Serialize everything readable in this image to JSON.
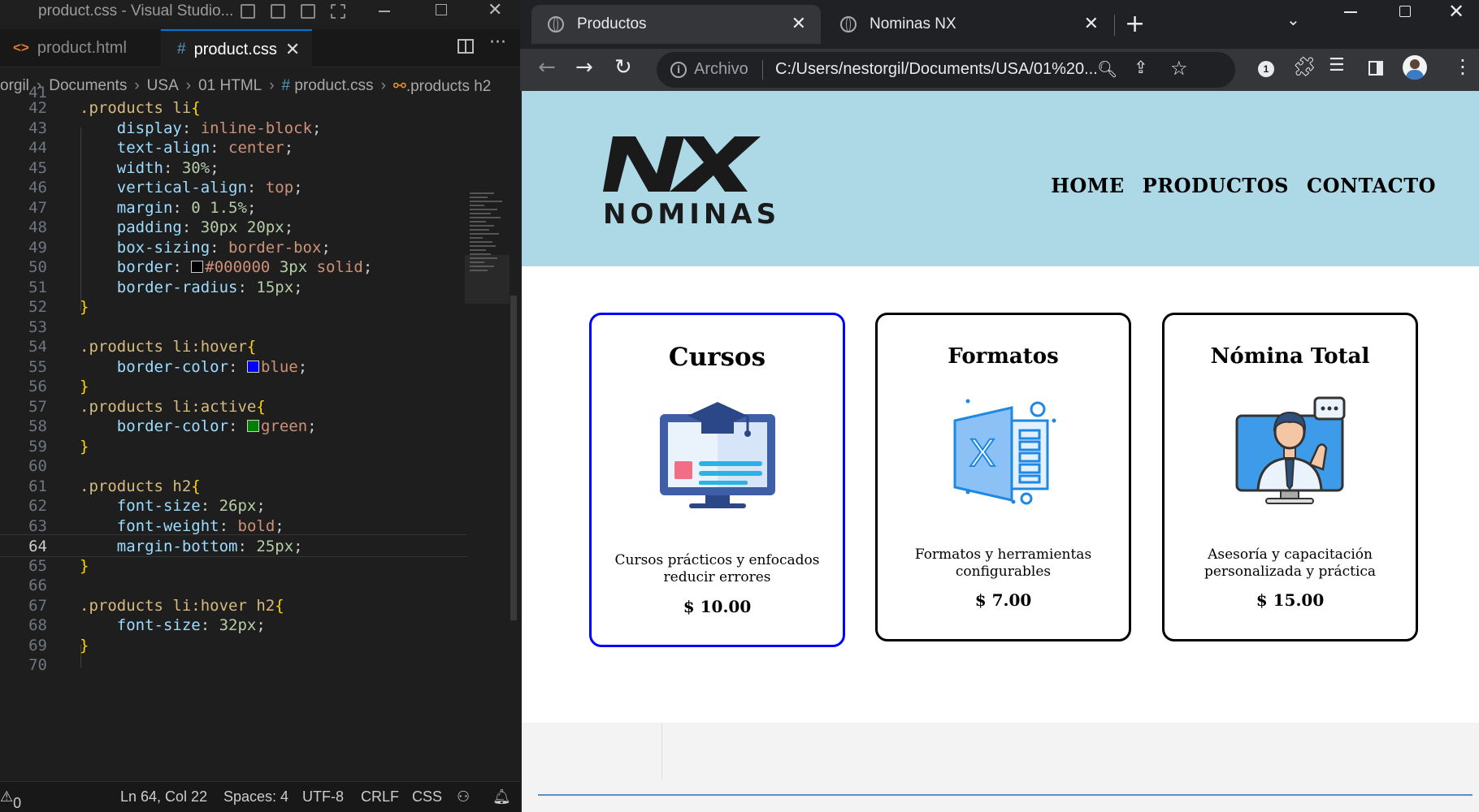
{
  "vscode": {
    "window_title": "product.css - Visual Studio...",
    "tabs": [
      {
        "label": "product.html",
        "active": false
      },
      {
        "label": "product.css",
        "active": true
      }
    ],
    "breadcrumb": [
      "orgil",
      "Documents",
      "USA",
      "01 HTML",
      "product.css",
      ".products h2"
    ],
    "lines": [
      {
        "n": "41"
      },
      {
        "n": "42"
      },
      {
        "n": "43"
      },
      {
        "n": "44"
      },
      {
        "n": "45"
      },
      {
        "n": "46"
      },
      {
        "n": "47"
      },
      {
        "n": "48"
      },
      {
        "n": "49"
      },
      {
        "n": "50"
      },
      {
        "n": "51"
      },
      {
        "n": "52"
      },
      {
        "n": "53"
      },
      {
        "n": "54"
      },
      {
        "n": "55"
      },
      {
        "n": "56"
      },
      {
        "n": "57"
      },
      {
        "n": "58"
      },
      {
        "n": "59"
      },
      {
        "n": "60"
      },
      {
        "n": "61"
      },
      {
        "n": "62"
      },
      {
        "n": "63"
      },
      {
        "n": "64"
      },
      {
        "n": "65"
      },
      {
        "n": "66"
      },
      {
        "n": "67"
      },
      {
        "n": "68"
      },
      {
        "n": "69"
      },
      {
        "n": "70"
      }
    ],
    "status": {
      "warnings": "0",
      "position": "Ln 64, Col 22",
      "spaces": "Spaces: 4",
      "encoding": "UTF-8",
      "eol": "CRLF",
      "language": "CSS"
    },
    "swatch_colors": {
      "black": "#000000",
      "blue": "#0000ff",
      "green": "#008000"
    }
  },
  "chrome": {
    "tabs": [
      {
        "label": "Productos",
        "active": true
      },
      {
        "label": "Nominas NX",
        "active": false
      }
    ],
    "omnibox": {
      "scheme_label": "Archivo",
      "url": "C:/Users/nestorgil/Documents/USA/01%20..."
    },
    "extension_badge": "1"
  },
  "site": {
    "header_bg": "#add8e6",
    "logo_word": "NOMINAS",
    "nav": [
      "HOME",
      "PRODUCTOS",
      "CONTACTO"
    ],
    "products": [
      {
        "title": "Cursos",
        "desc": "Cursos prácticos y enfocados reducir errores",
        "price": "$ 10.00",
        "border": "#0000ff"
      },
      {
        "title": "Formatos",
        "desc": "Formatos y herramientas configurables",
        "price": "$ 7.00",
        "border": "#000000"
      },
      {
        "title": "Nómina Total",
        "desc": "Asesoría y capacitación personalizada y práctica",
        "price": "$ 15.00",
        "border": "#000000"
      }
    ]
  }
}
